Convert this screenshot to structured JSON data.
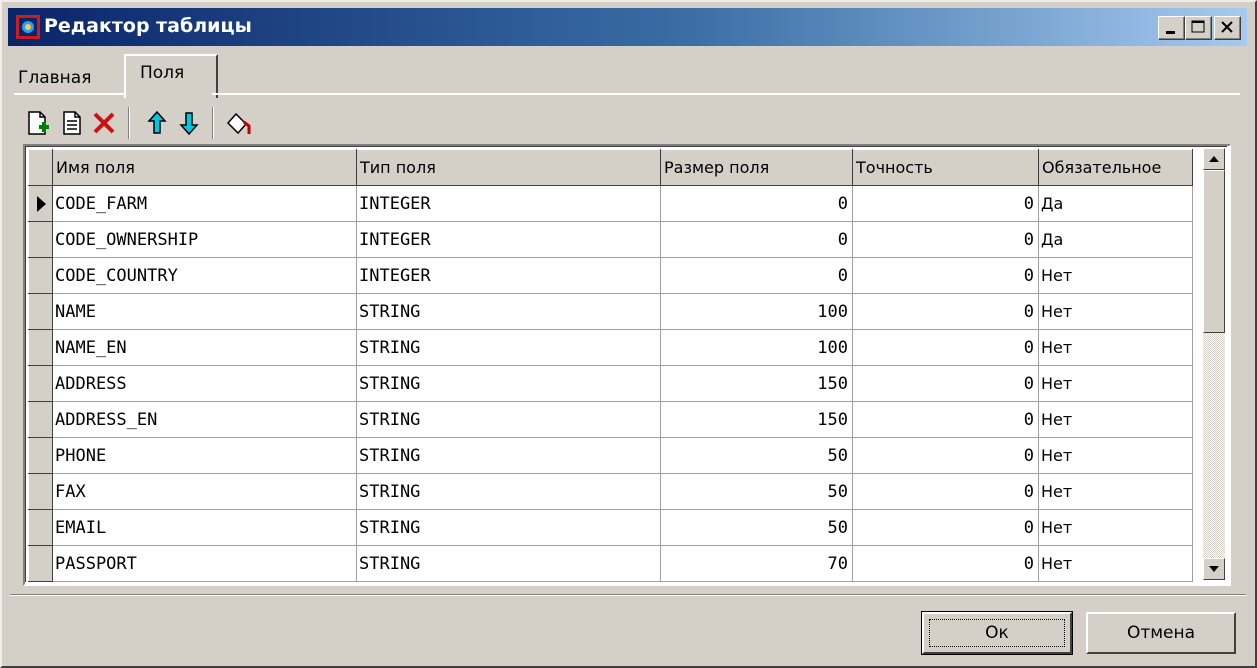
{
  "window": {
    "title": "Редактор таблицы",
    "icon": "table-editor-app-icon",
    "controls": [
      "minimize-icon",
      "maximize-icon",
      "close-icon"
    ]
  },
  "tabs": [
    {
      "label": "Главная",
      "active": false
    },
    {
      "label": "Поля",
      "active": true
    }
  ],
  "toolbar": {
    "items": [
      "add-field-icon",
      "edit-field-icon",
      "delete-icon",
      "move-up-icon",
      "move-down-icon",
      "clear-icon"
    ]
  },
  "grid": {
    "columns": [
      "Имя поля",
      "Тип поля",
      "Размер поля",
      "Точность",
      "Обязательное"
    ],
    "selected_row": 0,
    "rows": [
      [
        "CODE_FARM",
        "INTEGER",
        "0",
        "0",
        "Да"
      ],
      [
        "CODE_OWNERSHIP",
        "INTEGER",
        "0",
        "0",
        "Да"
      ],
      [
        "CODE_COUNTRY",
        "INTEGER",
        "0",
        "0",
        "Нет"
      ],
      [
        "NAME",
        "STRING",
        "100",
        "0",
        "Нет"
      ],
      [
        "NAME_EN",
        "STRING",
        "100",
        "0",
        "Нет"
      ],
      [
        "ADDRESS",
        "STRING",
        "150",
        "0",
        "Нет"
      ],
      [
        "ADDRESS_EN",
        "STRING",
        "150",
        "0",
        "Нет"
      ],
      [
        "PHONE",
        "STRING",
        "50",
        "0",
        "Нет"
      ],
      [
        "FAX",
        "STRING",
        "50",
        "0",
        "Нет"
      ],
      [
        "EMAIL",
        "STRING",
        "50",
        "0",
        "Нет"
      ],
      [
        "PASSPORT",
        "STRING",
        "70",
        "0",
        "Нет"
      ]
    ]
  },
  "buttons": {
    "ok": "Ок",
    "cancel": "Отмена"
  },
  "colors": {
    "titlebar_start": "#0a246a",
    "titlebar_end": "#a6caf0",
    "face": "#d4d0c8"
  }
}
